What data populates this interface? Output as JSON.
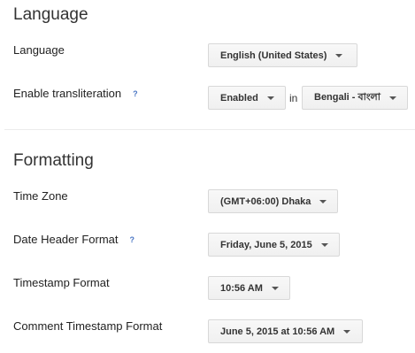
{
  "language_section": {
    "title": "Language",
    "language": {
      "label": "Language",
      "value": "English (United States)"
    },
    "transliteration": {
      "label": "Enable transliteration",
      "help": "?",
      "value": "Enabled",
      "in_label": "in",
      "script_value": "Bengali - বাংলা"
    }
  },
  "formatting_section": {
    "title": "Formatting",
    "time_zone": {
      "label": "Time Zone",
      "value": "(GMT+06:00) Dhaka"
    },
    "date_header_format": {
      "label": "Date Header Format",
      "help": "?",
      "value": "Friday, June 5, 2015"
    },
    "timestamp_format": {
      "label": "Timestamp Format",
      "value": "10:56 AM"
    },
    "comment_timestamp_format": {
      "label": "Comment Timestamp Format",
      "value": "June 5, 2015 at 10:56 AM"
    }
  }
}
